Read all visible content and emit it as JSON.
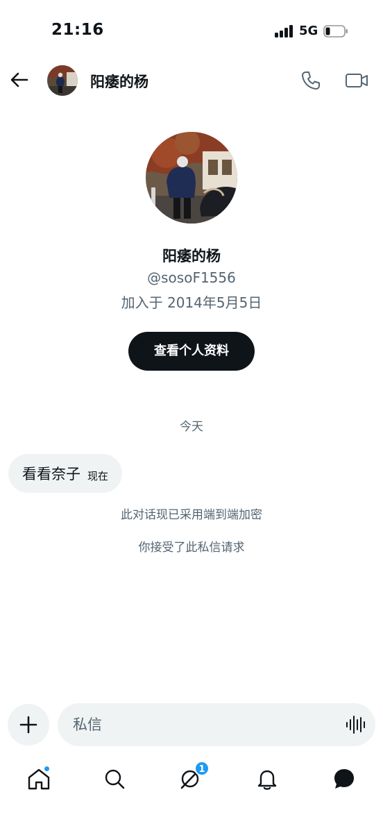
{
  "status_bar": {
    "time": "21:16",
    "network": "5G",
    "battery_level": 0.2
  },
  "header": {
    "name": "阳痿的杨"
  },
  "profile": {
    "name": "阳痿的杨",
    "handle": "@sosoF1556",
    "joined": "加入于 2014年5月5日",
    "view_profile_label": "查看个人资料"
  },
  "chat": {
    "date_divider": "今天",
    "messages": [
      {
        "text": "看看奈子",
        "time": "现在"
      }
    ],
    "encryption_notice": "此对话现已采用端到端加密",
    "accepted_notice": "你接受了此私信请求"
  },
  "composer": {
    "placeholder": "私信"
  },
  "bottom_nav": {
    "grok_badge": "1"
  },
  "colors": {
    "text": "#0f1419",
    "secondary": "#536471",
    "accent": "#1d9bf0",
    "surface": "#eff3f4"
  }
}
